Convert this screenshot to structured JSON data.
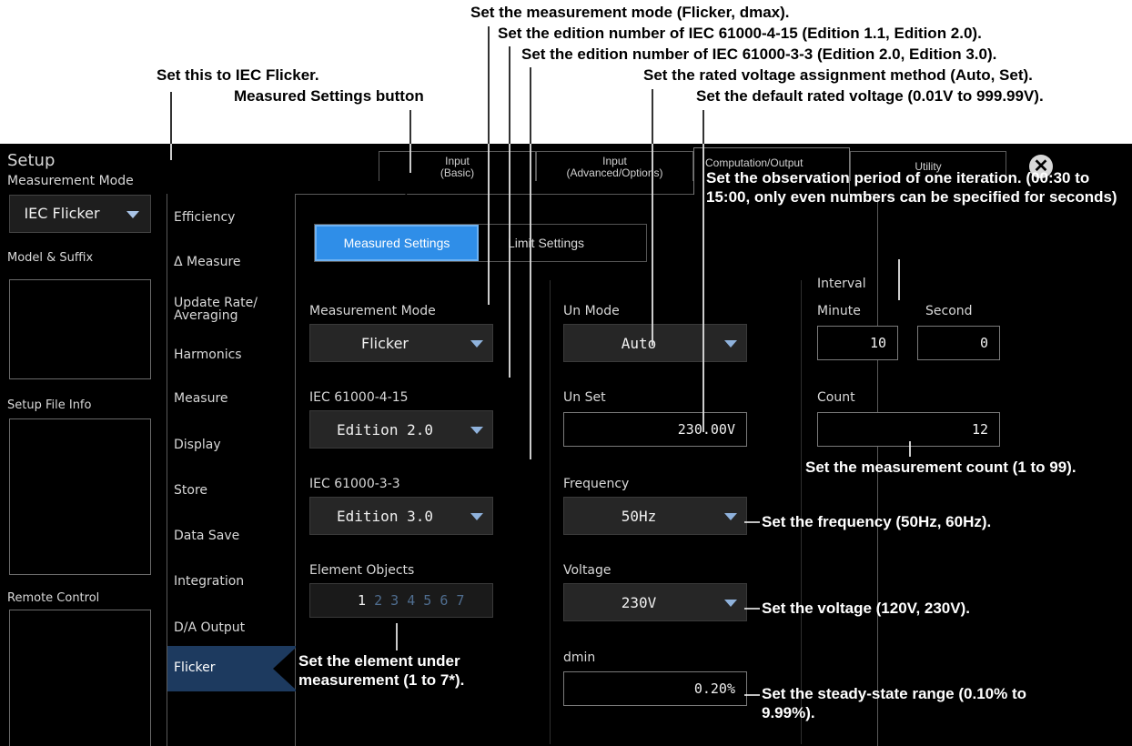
{
  "annotations": {
    "mode": "Set the measurement mode (Flicker, dmax).",
    "edition_4_15": "Set the edition number of IEC 61000-4-15 (Edition 1.1, Edition 2.0).",
    "edition_3_3": "Set the edition number of IEC 61000-3-3 (Edition 2.0, Edition 3.0).",
    "iec_flicker": "Set this to IEC Flicker.",
    "rated_assign": "Set the rated voltage assignment method (Auto, Set).",
    "measured_btn": "Measured Settings button",
    "default_voltage": "Set the default rated voltage (0.01V to 999.99V).",
    "observation": "Set the observation period of one iteration. (00:30 to 15:00, only even numbers can be specified for seconds)",
    "count": "Set the measurement count (1 to 99).",
    "frequency": "Set the frequency (50Hz, 60Hz).",
    "voltage": "Set the voltage (120V, 230V).",
    "element": "Set the element under measurement (1 to 7*).",
    "steady": "Set the steady-state range (0.10% to 9.99%)."
  },
  "screen": {
    "title": "Setup",
    "meas_mode_label": "Measurement Mode",
    "meas_mode_value": "IEC Flicker",
    "model_suffix_label": "Model & Suffix",
    "setup_file_label": "Setup File Info",
    "remote_label": "Remote Control",
    "tabs": [
      {
        "line1": "Input",
        "line2": "(Basic)"
      },
      {
        "line1": "Input",
        "line2": "(Advanced/Options)"
      },
      {
        "line1": "Computation/Output",
        "line2": ""
      },
      {
        "line1": "Utility",
        "line2": ""
      }
    ],
    "nav": [
      {
        "label": "Efficiency"
      },
      {
        "label": "Δ Measure"
      },
      {
        "label": "Update Rate/ Averaging"
      },
      {
        "label": "Harmonics"
      },
      {
        "label": "Measure"
      },
      {
        "label": "Display"
      },
      {
        "label": "Store"
      },
      {
        "label": "Data Save"
      },
      {
        "label": "Integration"
      },
      {
        "label": "D/A Output"
      },
      {
        "label": "Flicker"
      }
    ],
    "subtabs": {
      "measured": "Measured Settings",
      "limit": "Limit Settings"
    },
    "col1": {
      "mode_label": "Measurement Mode",
      "mode_value": "Flicker",
      "iec415_label": "IEC 61000-4-15",
      "iec415_value": "Edition 2.0",
      "iec33_label": "IEC 61000-3-3",
      "iec33_value": "Edition 3.0",
      "elem_label": "Element Objects",
      "elem_selected": "1",
      "elem_others": [
        "2",
        "3",
        "4",
        "5",
        "6",
        "7"
      ]
    },
    "col2": {
      "unmode_label": "Un Mode",
      "unmode_value": "Auto",
      "unset_label": "Un Set",
      "unset_value": "230.00V",
      "freq_label": "Frequency",
      "freq_value": "50Hz",
      "volt_label": "Voltage",
      "volt_value": "230V",
      "dmin_label": "dmin",
      "dmin_value": "0.20%"
    },
    "col3": {
      "interval_label": "Interval",
      "minute_label": "Minute",
      "second_label": "Second",
      "minute_value": "10",
      "second_value": "0",
      "count_label": "Count",
      "count_value": "12"
    }
  },
  "colors": {
    "accent": "#2f8ee8",
    "arrow": "#8fb2dc",
    "background": "#000000"
  }
}
